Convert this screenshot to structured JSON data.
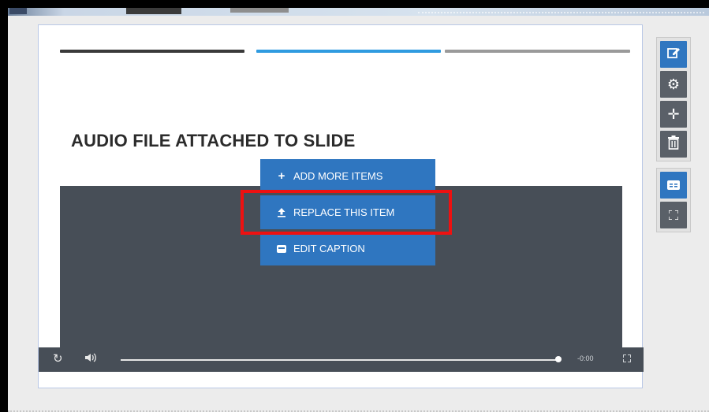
{
  "colors": {
    "accent": "#2f76c0",
    "highlight_border": "#ee1111",
    "progress_segments": [
      "#3a3a3a",
      "#2f9be0",
      "#9a9a9a"
    ],
    "media_bg": "#474e57"
  },
  "slide": {
    "title": "AUDIO FILE ATTACHED TO SLIDE"
  },
  "context_menu": {
    "items": [
      {
        "label": "ADD MORE ITEMS",
        "icon": "plus-icon"
      },
      {
        "label": "REPLACE THIS ITEM",
        "icon": "upload-icon"
      },
      {
        "label": "EDIT CAPTION",
        "icon": "closed-caption-icon"
      }
    ]
  },
  "player": {
    "time": "-0:00",
    "progress": 1.0,
    "icons": [
      "replay-icon",
      "volume-icon",
      "fullscreen-icon"
    ]
  },
  "toolbar": {
    "group1": [
      "edit-icon",
      "settings-gear-icon",
      "move-arrows-icon",
      "delete-trash-icon"
    ],
    "group2": [
      "closed-caption-icon",
      "expand-icon"
    ]
  }
}
